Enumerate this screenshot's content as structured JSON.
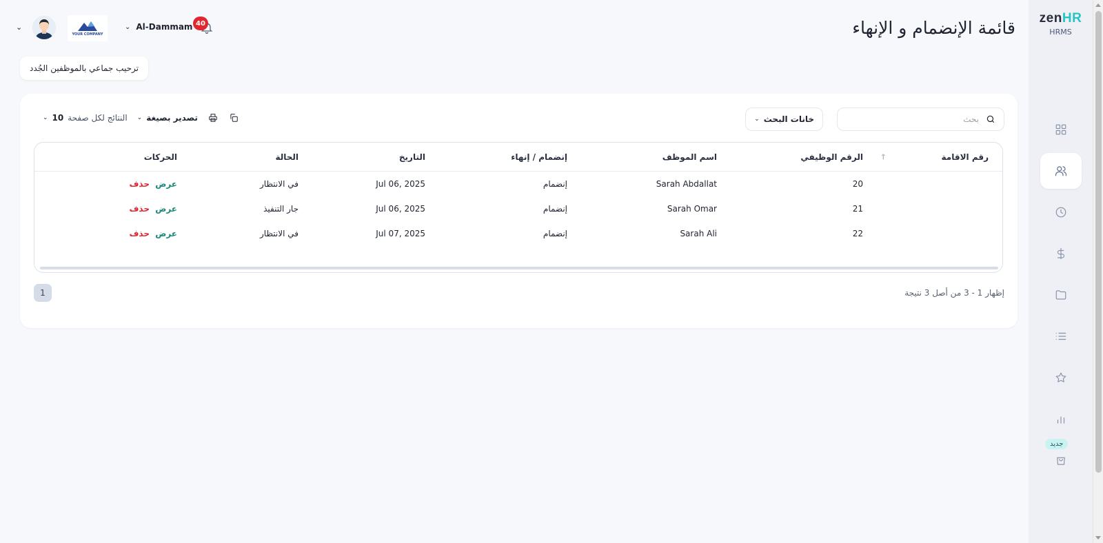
{
  "brand": {
    "logo_main": "zen",
    "logo_accent": "HR",
    "logo_sub": "HRMS"
  },
  "sidebar": {
    "items": [
      {
        "name": "dashboard",
        "icon": "grid-icon"
      },
      {
        "name": "employees",
        "icon": "users-icon",
        "active": true
      },
      {
        "name": "attendance",
        "icon": "clock-icon"
      },
      {
        "name": "payroll",
        "icon": "dollar-icon"
      },
      {
        "name": "documents",
        "icon": "folder-icon"
      },
      {
        "name": "lists",
        "icon": "list-icon"
      },
      {
        "name": "performance",
        "icon": "star-icon"
      },
      {
        "name": "reports",
        "icon": "bar-chart-icon"
      },
      {
        "name": "marketplace",
        "icon": "bag-icon"
      }
    ],
    "new_badge": "جديد"
  },
  "header": {
    "title": "قائمة الإنضمام و الإنهاء",
    "notifications_count": "40",
    "branch": "Al-Dammam",
    "company_logo_text": "YOUR COMPANY"
  },
  "actions": {
    "welcome_button": "ترحيب جماعي بالموظفين الجُدد"
  },
  "toolbar": {
    "search_placeholder": "بحث",
    "search_fields": "خانات البحث",
    "per_page_label": "النتائج لكل صفحة",
    "per_page_value": "10",
    "export_label": "تصدير بصيغة"
  },
  "table": {
    "columns": {
      "residency": "رقم الاقامة",
      "employee_no": "الرقم الوظيفي",
      "employee_name": "اسم الموظف",
      "type": "إنضمام / إنهاء",
      "date": "التاريخ",
      "status": "الحالة",
      "actions": "الحركات"
    },
    "rows": [
      {
        "residency": "",
        "employee_no": "20",
        "employee_name": "Sarah Abdallat",
        "type": "إنضمام",
        "date": "Jul 06, 2025",
        "status": "في الانتظار",
        "view": "عرض",
        "delete": "حذف"
      },
      {
        "residency": "",
        "employee_no": "21",
        "employee_name": "Sarah Omar",
        "type": "إنضمام",
        "date": "Jul 06, 2025",
        "status": "جار التنفيذ",
        "view": "عرض",
        "delete": "حذف"
      },
      {
        "residency": "",
        "employee_no": "22",
        "employee_name": "Sarah Ali",
        "type": "إنضمام",
        "date": "Jul 07, 2025",
        "status": "في الانتظار",
        "view": "عرض",
        "delete": "حذف"
      }
    ]
  },
  "pagination": {
    "current_page": "1",
    "summary": "إظهار 1 - 3 من أصل 3 نتيجة"
  },
  "colors": {
    "accent_teal": "#1a8a7a",
    "danger_red": "#e0262f",
    "brand_teal": "#27c4c4"
  }
}
